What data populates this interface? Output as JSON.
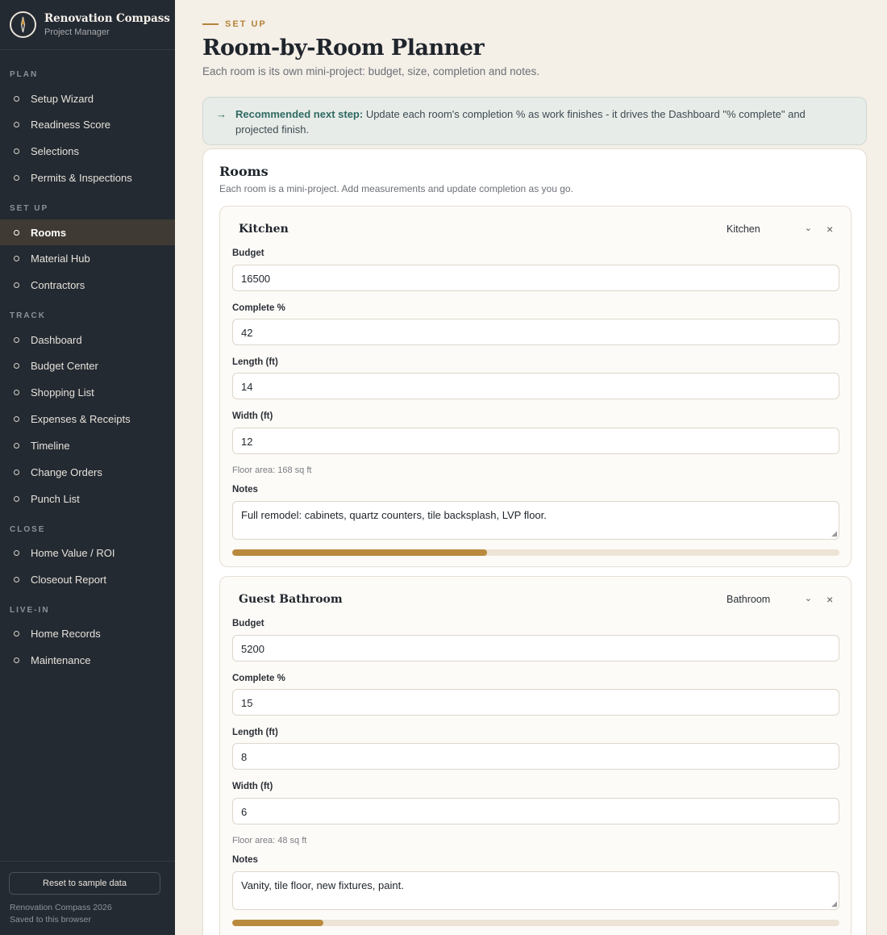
{
  "brand": {
    "title": "Renovation Compass",
    "subtitle": "Project Manager",
    "icon": "compass-icon"
  },
  "nav": {
    "sections": [
      {
        "label": "PLAN",
        "items": [
          "Setup Wizard",
          "Readiness Score",
          "Selections",
          "Permits & Inspections"
        ]
      },
      {
        "label": "SET UP",
        "items": [
          "Rooms",
          "Material Hub",
          "Contractors"
        ]
      },
      {
        "label": "TRACK",
        "items": [
          "Dashboard",
          "Budget Center",
          "Shopping List",
          "Expenses & Receipts",
          "Timeline",
          "Change Orders",
          "Punch List"
        ]
      },
      {
        "label": "CLOSE",
        "items": [
          "Home Value / ROI",
          "Closeout Report"
        ]
      },
      {
        "label": "LIVE-IN",
        "items": [
          "Home Records",
          "Maintenance"
        ]
      }
    ],
    "active": "Rooms"
  },
  "footer": {
    "reset_label": "Reset to sample data",
    "copyright": "Renovation Compass 2026",
    "saved": "Saved to this browser"
  },
  "header": {
    "eyebrow": "SET UP",
    "title": "Room-by-Room Planner",
    "subtitle": "Each room is its own mini-project: budget, size, completion and notes."
  },
  "banner": {
    "lead": "Recommended next step:",
    "text": " Update each room's completion % as work finishes - it drives the Dashboard \"% complete\" and projected finish."
  },
  "rooms_card": {
    "title": "Rooms",
    "subtitle": "Each room is a mini-project. Add measurements and update completion as you go."
  },
  "labels": {
    "budget": "Budget",
    "complete": "Complete %",
    "length": "Length (ft)",
    "width": "Width (ft)",
    "notes": "Notes"
  },
  "rooms": [
    {
      "name": "Kitchen",
      "type": "Kitchen",
      "budget": "16500",
      "complete": "42",
      "length": "14",
      "width": "12",
      "area": "Floor area: 168 sq ft",
      "notes": "Full remodel: cabinets, quartz counters, tile backsplash, LVP floor.",
      "progress": 0.42
    },
    {
      "name": "Guest Bathroom",
      "type": "Bathroom",
      "budget": "5200",
      "complete": "15",
      "length": "8",
      "width": "6",
      "area": "Floor area: 48 sq ft",
      "notes": "Vanity, tile floor, new fixtures, paint.",
      "progress": 0.15
    }
  ],
  "colors": {
    "accent": "#b98a3e",
    "sidebar": "#242a32",
    "teal": "#2f6a63"
  }
}
